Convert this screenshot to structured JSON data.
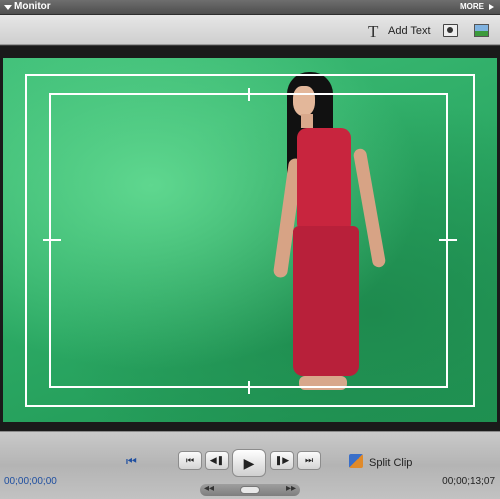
{
  "panel": {
    "title": "Monitor",
    "more": "MORE"
  },
  "toolbar": {
    "add_text_label": "Add Text"
  },
  "controls": {
    "current_timecode": "00;00;00;00",
    "total_timecode": "00;00;13;07",
    "split_clip_label": "Split Clip"
  },
  "icons": {
    "panel_menu": "triangle-down-icon",
    "more_menu": "triangle-right-icon",
    "add_text": "text-T-icon",
    "snapshot": "camera-icon",
    "image_properties": "image-icon",
    "go_to_start": "home-icon",
    "prev_edit": "skip-back-icon",
    "step_back": "step-back-icon",
    "play": "play-icon",
    "step_forward": "step-forward-icon",
    "next_edit": "skip-forward-icon",
    "split_clip": "scissors-icon",
    "shuttle": "shuttle-icon"
  },
  "colors": {
    "greenscreen": "#2aa762",
    "guide_lines": "#ffffff",
    "timecode_current": "#1f4fa0",
    "panel_toolbar": "#dcdcdc",
    "controls_bar": "#bdbdbd"
  }
}
